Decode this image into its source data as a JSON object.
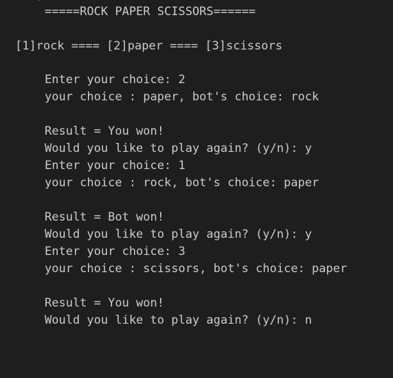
{
  "terminal": {
    "top_cut": "- •  )",
    "title": "=====ROCK PAPER SCISSORS======",
    "menu": "[1]rock ==== [2]paper ==== [3]scissors",
    "lines": [
      "Enter your choice: 2",
      "your choice : paper, bot's choice: rock",
      "Result = You won!",
      "Would you like to play again? (y/n): y",
      "Enter your choice: 1",
      "your choice : rock, bot's choice: paper",
      "Result = Bot won!",
      "Would you like to play again? (y/n): y",
      "Enter your choice: 3",
      "your choice : scissors, bot's choice: paper",
      "Result = You won!",
      "Would you like to play again? (y/n): n"
    ]
  },
  "colors": {
    "background": "#1e1e1e",
    "text": "#cccccc",
    "top_fragment": "#3b8eea"
  }
}
